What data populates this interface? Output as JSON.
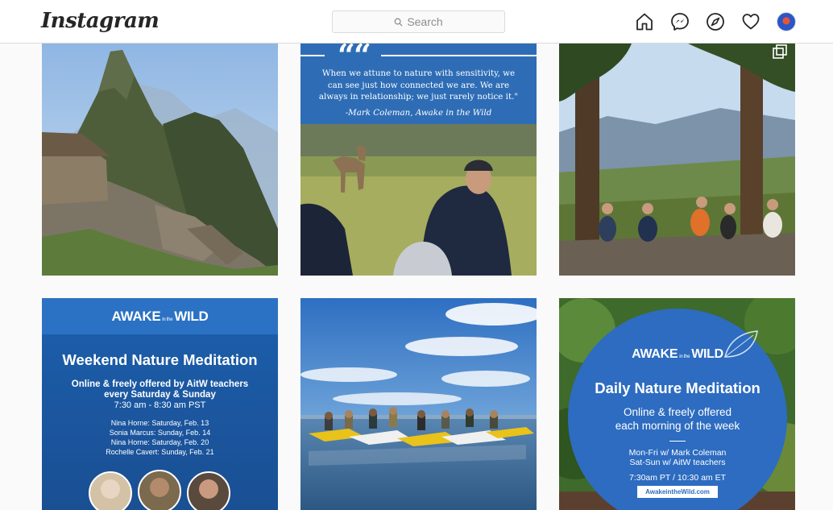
{
  "header": {
    "logo": "Instagram",
    "search_placeholder": "Search",
    "nav_icons": [
      "home-icon",
      "messenger-icon",
      "explore-icon",
      "heart-icon",
      "avatar"
    ]
  },
  "posts": [
    {
      "label": "Machu Picchu mountain photo"
    },
    {
      "quote": "When we attune to nature with sensitivity, we can see just how connected we are. We are always in relationship; we just rarely notice it.\"",
      "attribution": "-Mark Coleman, Awake in the Wild"
    },
    {
      "label": "Group meditating in forest",
      "multi_icon": "multiple-photos-icon"
    },
    {
      "brand_left": "AWAKE",
      "brand_mid": "in the",
      "brand_right": "WILD",
      "title": "Weekend Nature Meditation",
      "subtitle_1": "Online & freely offered by AitW teachers",
      "subtitle_2": "every Saturday & Sunday",
      "time": "7:30 am - 8:30 am PST",
      "schedule": [
        "Nina Horne: Saturday, Feb. 13",
        "Sonia Marcus: Sunday, Feb. 14",
        "Nina Horne: Saturday, Feb. 20",
        "Rochelle Cavert: Sunday, Feb. 21"
      ]
    },
    {
      "label": "Kayakers on a lake"
    },
    {
      "brand_left": "AWAKE",
      "brand_mid": "in the",
      "brand_right": "WILD",
      "title": "Daily Nature Meditation",
      "subtitle_1": "Online & freely offered",
      "subtitle_2": "each morning of the week",
      "line_1": "Mon-Fri w/ Mark Coleman",
      "line_2": "Sat-Sun w/ AitW teachers",
      "time": "7:30am PT / 10:30 am ET",
      "url": "AwakeintheWild.com"
    }
  ],
  "colors": {
    "header_bg": "#ffffff",
    "page_bg": "#fafafa",
    "border": "#dbdbdb",
    "poster_blue": "#1c5fad"
  }
}
